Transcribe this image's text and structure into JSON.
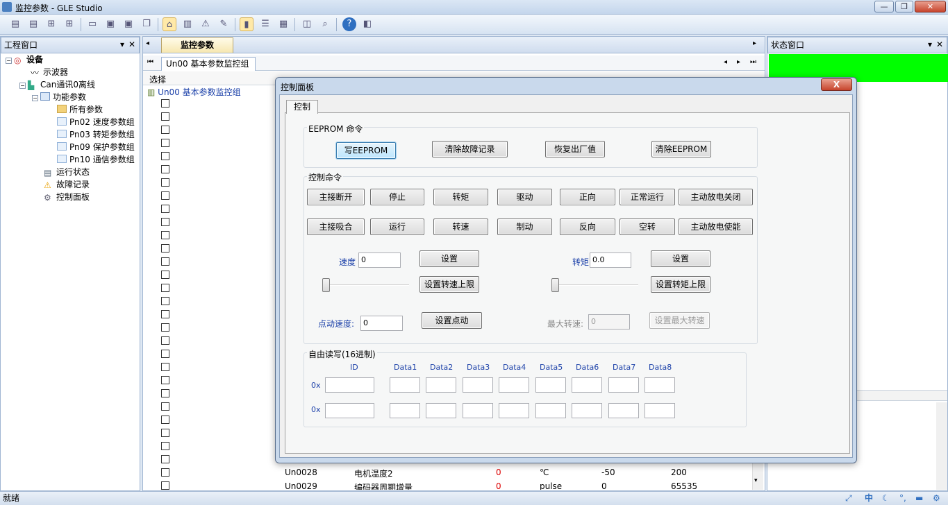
{
  "window": {
    "title": "监控参数 - GLE Studio",
    "min": "—",
    "max": "❐",
    "close": "✕"
  },
  "left_panel": {
    "title": "工程窗口",
    "tree": [
      {
        "label": "设备",
        "level": 0,
        "bold": true
      },
      {
        "label": "示波器",
        "level": 1
      },
      {
        "label": "Can通讯0离线",
        "level": 1
      },
      {
        "label": "功能参数",
        "level": 2
      },
      {
        "label": "所有参数",
        "level": 3
      },
      {
        "label": "Pn02 速度参数组",
        "level": 3
      },
      {
        "label": "Pn03 转矩参数组",
        "level": 3
      },
      {
        "label": "Pn09 保护参数组",
        "level": 3
      },
      {
        "label": "Pn10 通信参数组",
        "level": 3
      },
      {
        "label": "运行状态",
        "level": 2
      },
      {
        "label": "故障记录",
        "level": 2
      },
      {
        "label": "控制面板",
        "level": 2
      }
    ]
  },
  "center": {
    "doc_tab": "监控参数",
    "sub_tab": "Un00 基本参数监控组",
    "select_header": "选择",
    "group_row": "Un00 基本参数监控组",
    "rows": [
      {
        "code": "Un0028",
        "name": "电机温度2",
        "value": "0",
        "unit": "℃",
        "min": "-50",
        "max": "200"
      },
      {
        "code": "Un0029",
        "name": "编码器周期增量",
        "value": "0",
        "unit": "pulse",
        "min": "0",
        "max": "65535"
      }
    ]
  },
  "right_panel": {
    "title": "状态窗口",
    "status_color": "#00ff00"
  },
  "statusbar": {
    "text": "就绪",
    "tray": [
      "中"
    ]
  },
  "dialog": {
    "title": "控制面板",
    "close": "X",
    "tab": "控制",
    "eeprom": {
      "label": "EEPROM 命令",
      "buttons": [
        "写EEPROM",
        "清除故障记录",
        "恢复出厂值",
        "清除EEPROM"
      ]
    },
    "control": {
      "label": "控制命令",
      "row1": [
        "主接断开",
        "停止",
        "转矩",
        "驱动",
        "正向",
        "正常运行",
        "主动放电关闭"
      ],
      "row2": [
        "主接吸合",
        "运行",
        "转速",
        "制动",
        "反向",
        "空转",
        "主动放电使能"
      ]
    },
    "speed": {
      "label": "速度",
      "value": "0",
      "set": "设置",
      "set_limit": "设置转速上限",
      "slider": 0
    },
    "torque": {
      "label": "转矩",
      "value": "0.0",
      "set": "设置",
      "set_limit": "设置转矩上限",
      "slider": 0
    },
    "jog": {
      "label": "点动速度:",
      "value": "0",
      "set": "设置点动"
    },
    "max_speed": {
      "label": "最大转速:",
      "value": "0",
      "set": "设置最大转速"
    },
    "free_rw": {
      "label": "自由读写(16进制)",
      "prefix": "0x",
      "headers": [
        "ID",
        "Data1",
        "Data2",
        "Data3",
        "Data4",
        "Data5",
        "Data6",
        "Data7",
        "Data8"
      ]
    }
  }
}
